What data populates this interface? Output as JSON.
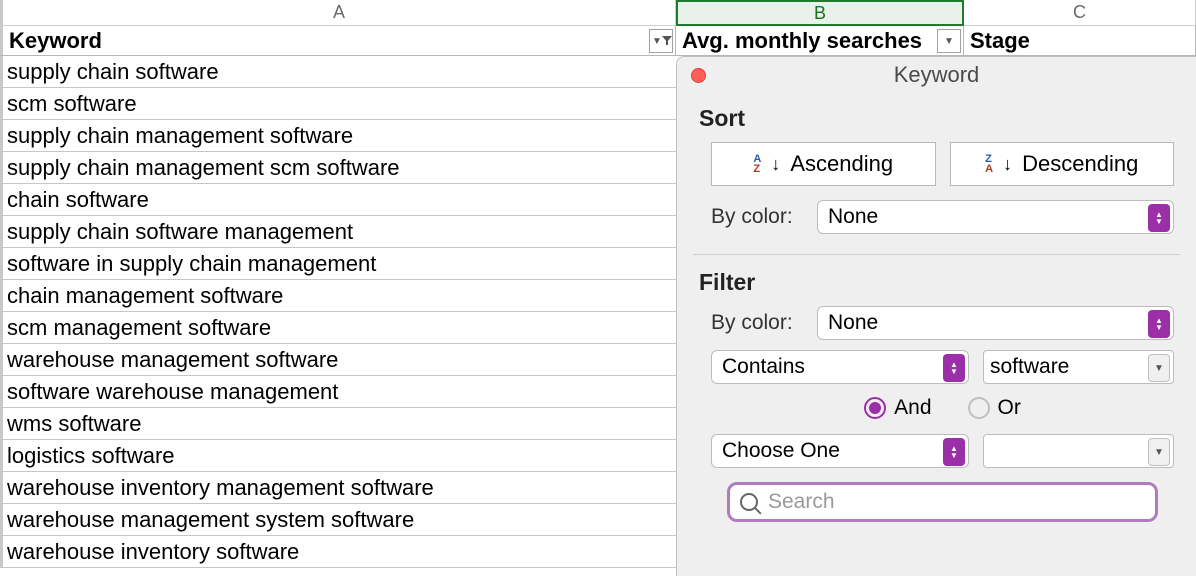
{
  "columns": {
    "A": "A",
    "B": "B",
    "C": "C"
  },
  "headers": {
    "A": "Keyword",
    "B": "Avg. monthly searches",
    "C": "Stage"
  },
  "rows": [
    "supply chain software",
    "scm software",
    "supply chain management software",
    "supply chain management scm software",
    "chain software",
    "supply chain software management",
    "software in supply chain management",
    "chain management software",
    "scm management software",
    "warehouse management software",
    "software warehouse management",
    "wms software",
    "logistics software",
    "warehouse inventory management software",
    "warehouse management system software",
    "warehouse inventory software"
  ],
  "panel": {
    "title": "Keyword",
    "sort_label": "Sort",
    "ascending": "Ascending",
    "descending": "Descending",
    "by_color": "By color:",
    "none": "None",
    "filter_label": "Filter",
    "condition1": "Contains",
    "value1": "software",
    "and": "And",
    "or": "Or",
    "condition2": "Choose One",
    "value2": "",
    "search_placeholder": "Search"
  }
}
